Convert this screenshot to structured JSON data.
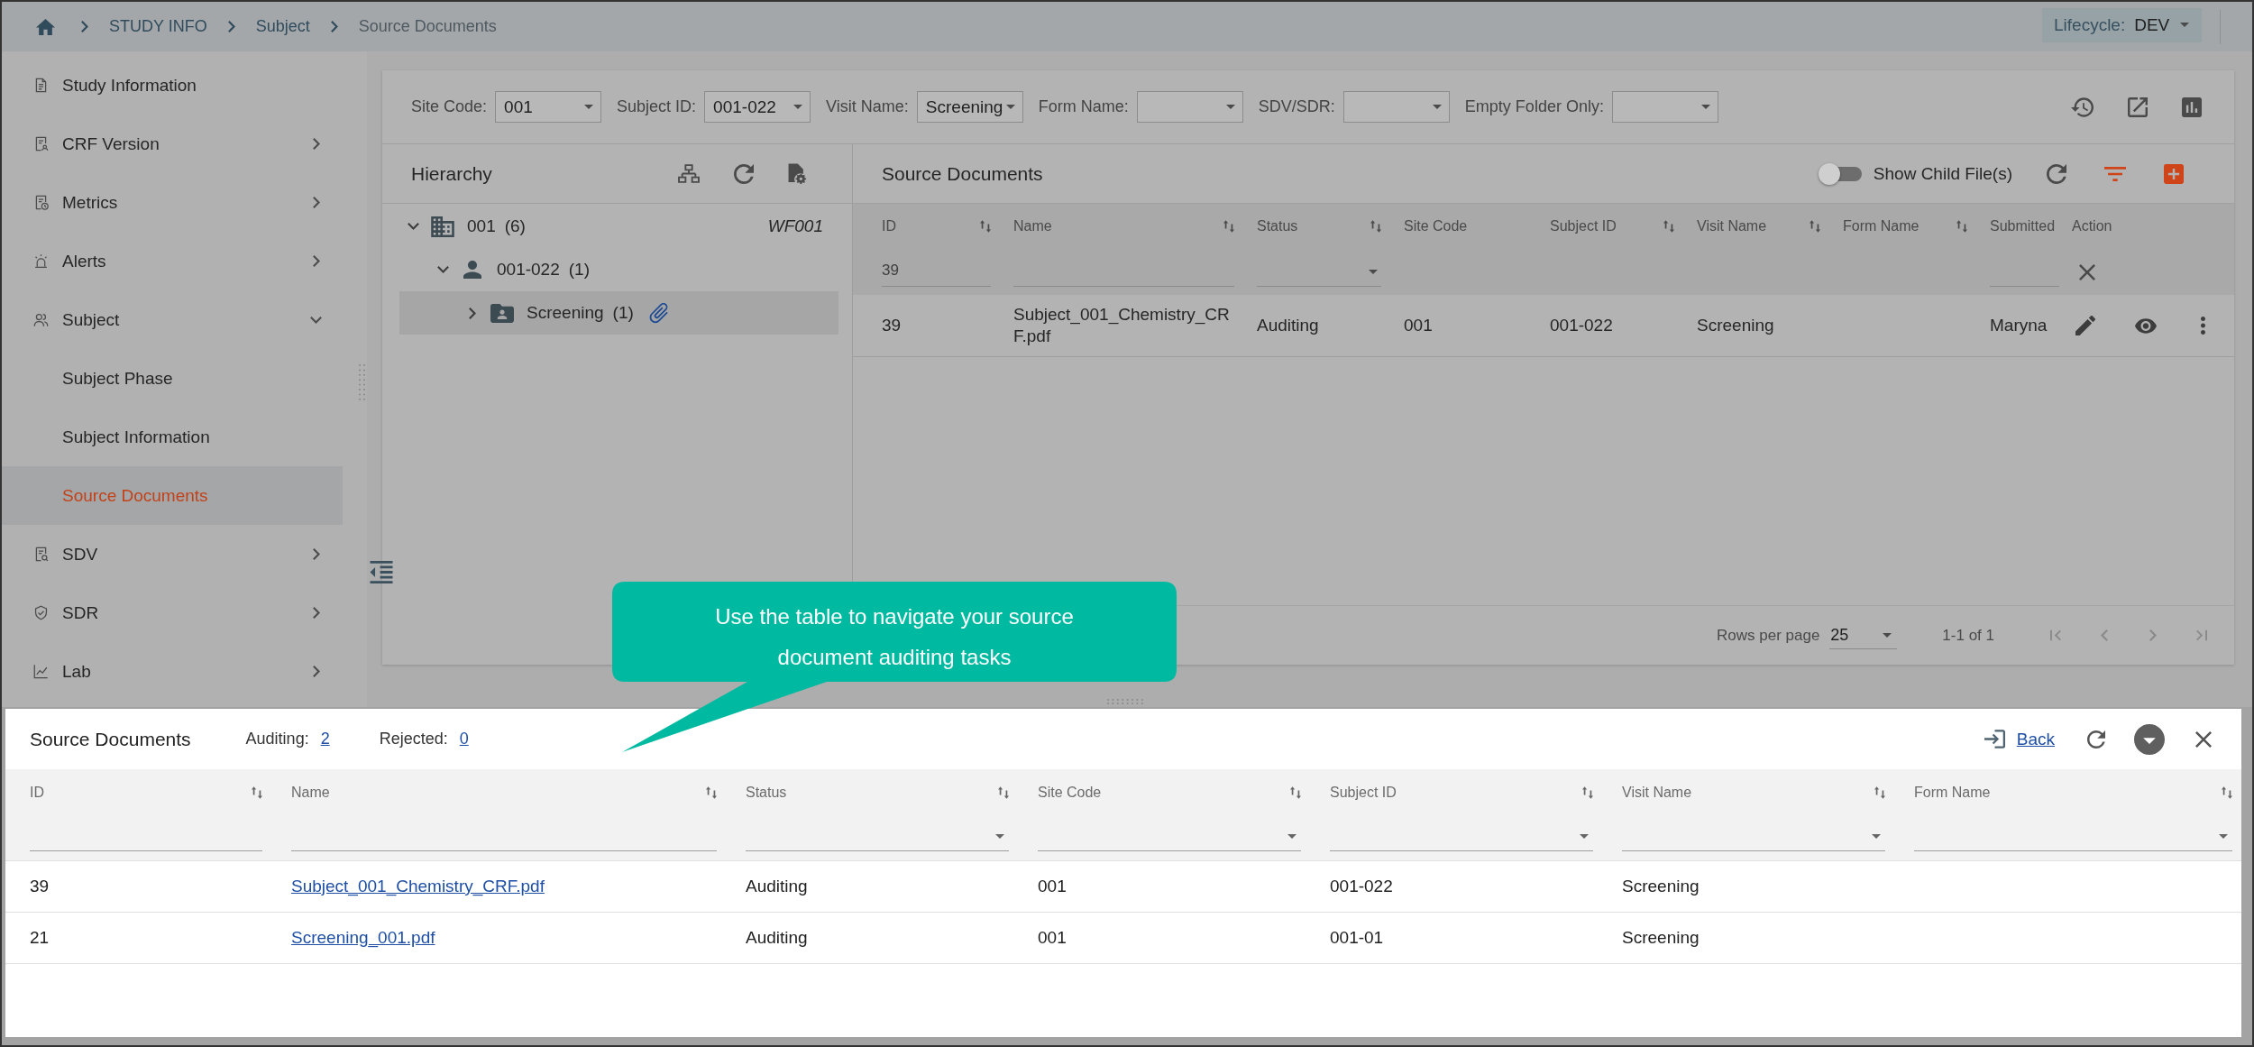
{
  "breadcrumb": [
    {
      "label": "STUDY INFO",
      "current": false
    },
    {
      "label": "Subject",
      "current": false
    },
    {
      "label": "Source Documents",
      "current": true
    }
  ],
  "lifecycle": {
    "label": "Lifecycle:",
    "value": "DEV"
  },
  "sidebar": {
    "items": [
      {
        "label": "Study Information",
        "kind": "page",
        "selected": false
      },
      {
        "label": "CRF Version",
        "kind": "group",
        "expanded": false,
        "selected": false
      },
      {
        "label": "Metrics",
        "kind": "group",
        "expanded": false,
        "selected": false
      },
      {
        "label": "Alerts",
        "kind": "group",
        "expanded": false,
        "selected": false
      },
      {
        "label": "Subject",
        "kind": "group",
        "expanded": true,
        "selected": false,
        "children": [
          {
            "label": "Subject Phase",
            "selected": false
          },
          {
            "label": "Subject Information",
            "selected": false
          },
          {
            "label": "Source Documents",
            "selected": true
          }
        ]
      },
      {
        "label": "SDV",
        "kind": "group",
        "expanded": false,
        "selected": false
      },
      {
        "label": "SDR",
        "kind": "group",
        "expanded": false,
        "selected": false
      },
      {
        "label": "Lab",
        "kind": "group",
        "expanded": false,
        "selected": false
      }
    ]
  },
  "filters": [
    {
      "label": "Site Code:",
      "value": "001"
    },
    {
      "label": "Subject ID:",
      "value": "001-022"
    },
    {
      "label": "Visit Name:",
      "value": "Screening"
    },
    {
      "label": "Form Name:"
    },
    {
      "label": "SDV/SDR:"
    },
    {
      "label": "Empty Folder Only:"
    }
  ],
  "hierarchy": {
    "title": "Hierarchy",
    "tree": [
      {
        "kind": "site",
        "label": "001",
        "count": "(6)",
        "tag": "WF001",
        "expanded": true,
        "selected": false,
        "attachment": false,
        "children": [
          {
            "kind": "subject",
            "label": "001-022",
            "count": "(1)",
            "expanded": true,
            "selected": false,
            "attachment": false,
            "children": [
              {
                "kind": "visit",
                "label": "Screening",
                "count": "(1)",
                "expanded": false,
                "selected": true,
                "attachment": true
              }
            ]
          }
        ]
      }
    ]
  },
  "documents": {
    "title": "Source Documents",
    "child_files": {
      "label": "Show Child File(s)",
      "on": false
    },
    "columns": [
      {
        "label": "ID",
        "kind": "text",
        "sortable": true,
        "filter": {
          "kind": "text",
          "value": "39"
        }
      },
      {
        "label": "Name",
        "kind": "text",
        "sortable": true,
        "filter": {
          "kind": "text"
        }
      },
      {
        "label": "Status",
        "kind": "text",
        "sortable": true,
        "filter": {
          "kind": "select"
        }
      },
      {
        "label": "Site Code",
        "kind": "text",
        "sortable": false
      },
      {
        "label": "Subject ID",
        "kind": "text",
        "sortable": true
      },
      {
        "label": "Visit Name",
        "kind": "text",
        "sortable": true
      },
      {
        "label": "Form Name",
        "kind": "text",
        "sortable": true
      },
      {
        "label": "Submitted",
        "kind": "text",
        "sortable": false,
        "filter": {
          "kind": "text"
        }
      },
      {
        "label": "Action",
        "kind": "actions",
        "sortable": false,
        "filter": {
          "kind": "clear"
        }
      }
    ],
    "rows": [
      {
        "cells": [
          "39",
          "Subject_001_Chemistry_CRF.pdf",
          "Auditing",
          "001",
          "001-022",
          "Screening",
          null,
          "Maryna"
        ]
      }
    ],
    "pagination": {
      "rows_label": "Rows per page",
      "rows_value": "25",
      "range": "1-1 of 1",
      "nav_disabled": true
    }
  },
  "callout": {
    "text": "Use the table to navigate your source document auditing tasks"
  },
  "queue": {
    "title": "Source Documents",
    "counts": [
      {
        "label": "Auditing:",
        "value": "2"
      },
      {
        "label": "Rejected:",
        "value": "0"
      }
    ],
    "back": "Back",
    "columns": [
      {
        "label": "ID",
        "sortable": true,
        "filter": {
          "kind": "text"
        },
        "link": false
      },
      {
        "label": "Name",
        "sortable": true,
        "filter": {
          "kind": "text"
        },
        "link": true
      },
      {
        "label": "Status",
        "sortable": true,
        "filter": {
          "kind": "select"
        },
        "link": false
      },
      {
        "label": "Site Code",
        "sortable": true,
        "filter": {
          "kind": "select"
        },
        "link": false
      },
      {
        "label": "Subject ID",
        "sortable": true,
        "filter": {
          "kind": "select"
        },
        "link": false
      },
      {
        "label": "Visit Name",
        "sortable": true,
        "filter": {
          "kind": "select"
        },
        "link": false
      },
      {
        "label": "Form Name",
        "sortable": true,
        "filter": {
          "kind": "select"
        }
      }
    ],
    "rows": [
      {
        "cells": [
          "39",
          "Subject_001_Chemistry_CRF.pdf",
          "Auditing",
          "001",
          "001-022",
          "Screening",
          null
        ]
      },
      {
        "cells": [
          "21",
          "Screening_001.pdf",
          "Auditing",
          "001",
          "001-01",
          "Screening",
          null
        ]
      }
    ]
  }
}
